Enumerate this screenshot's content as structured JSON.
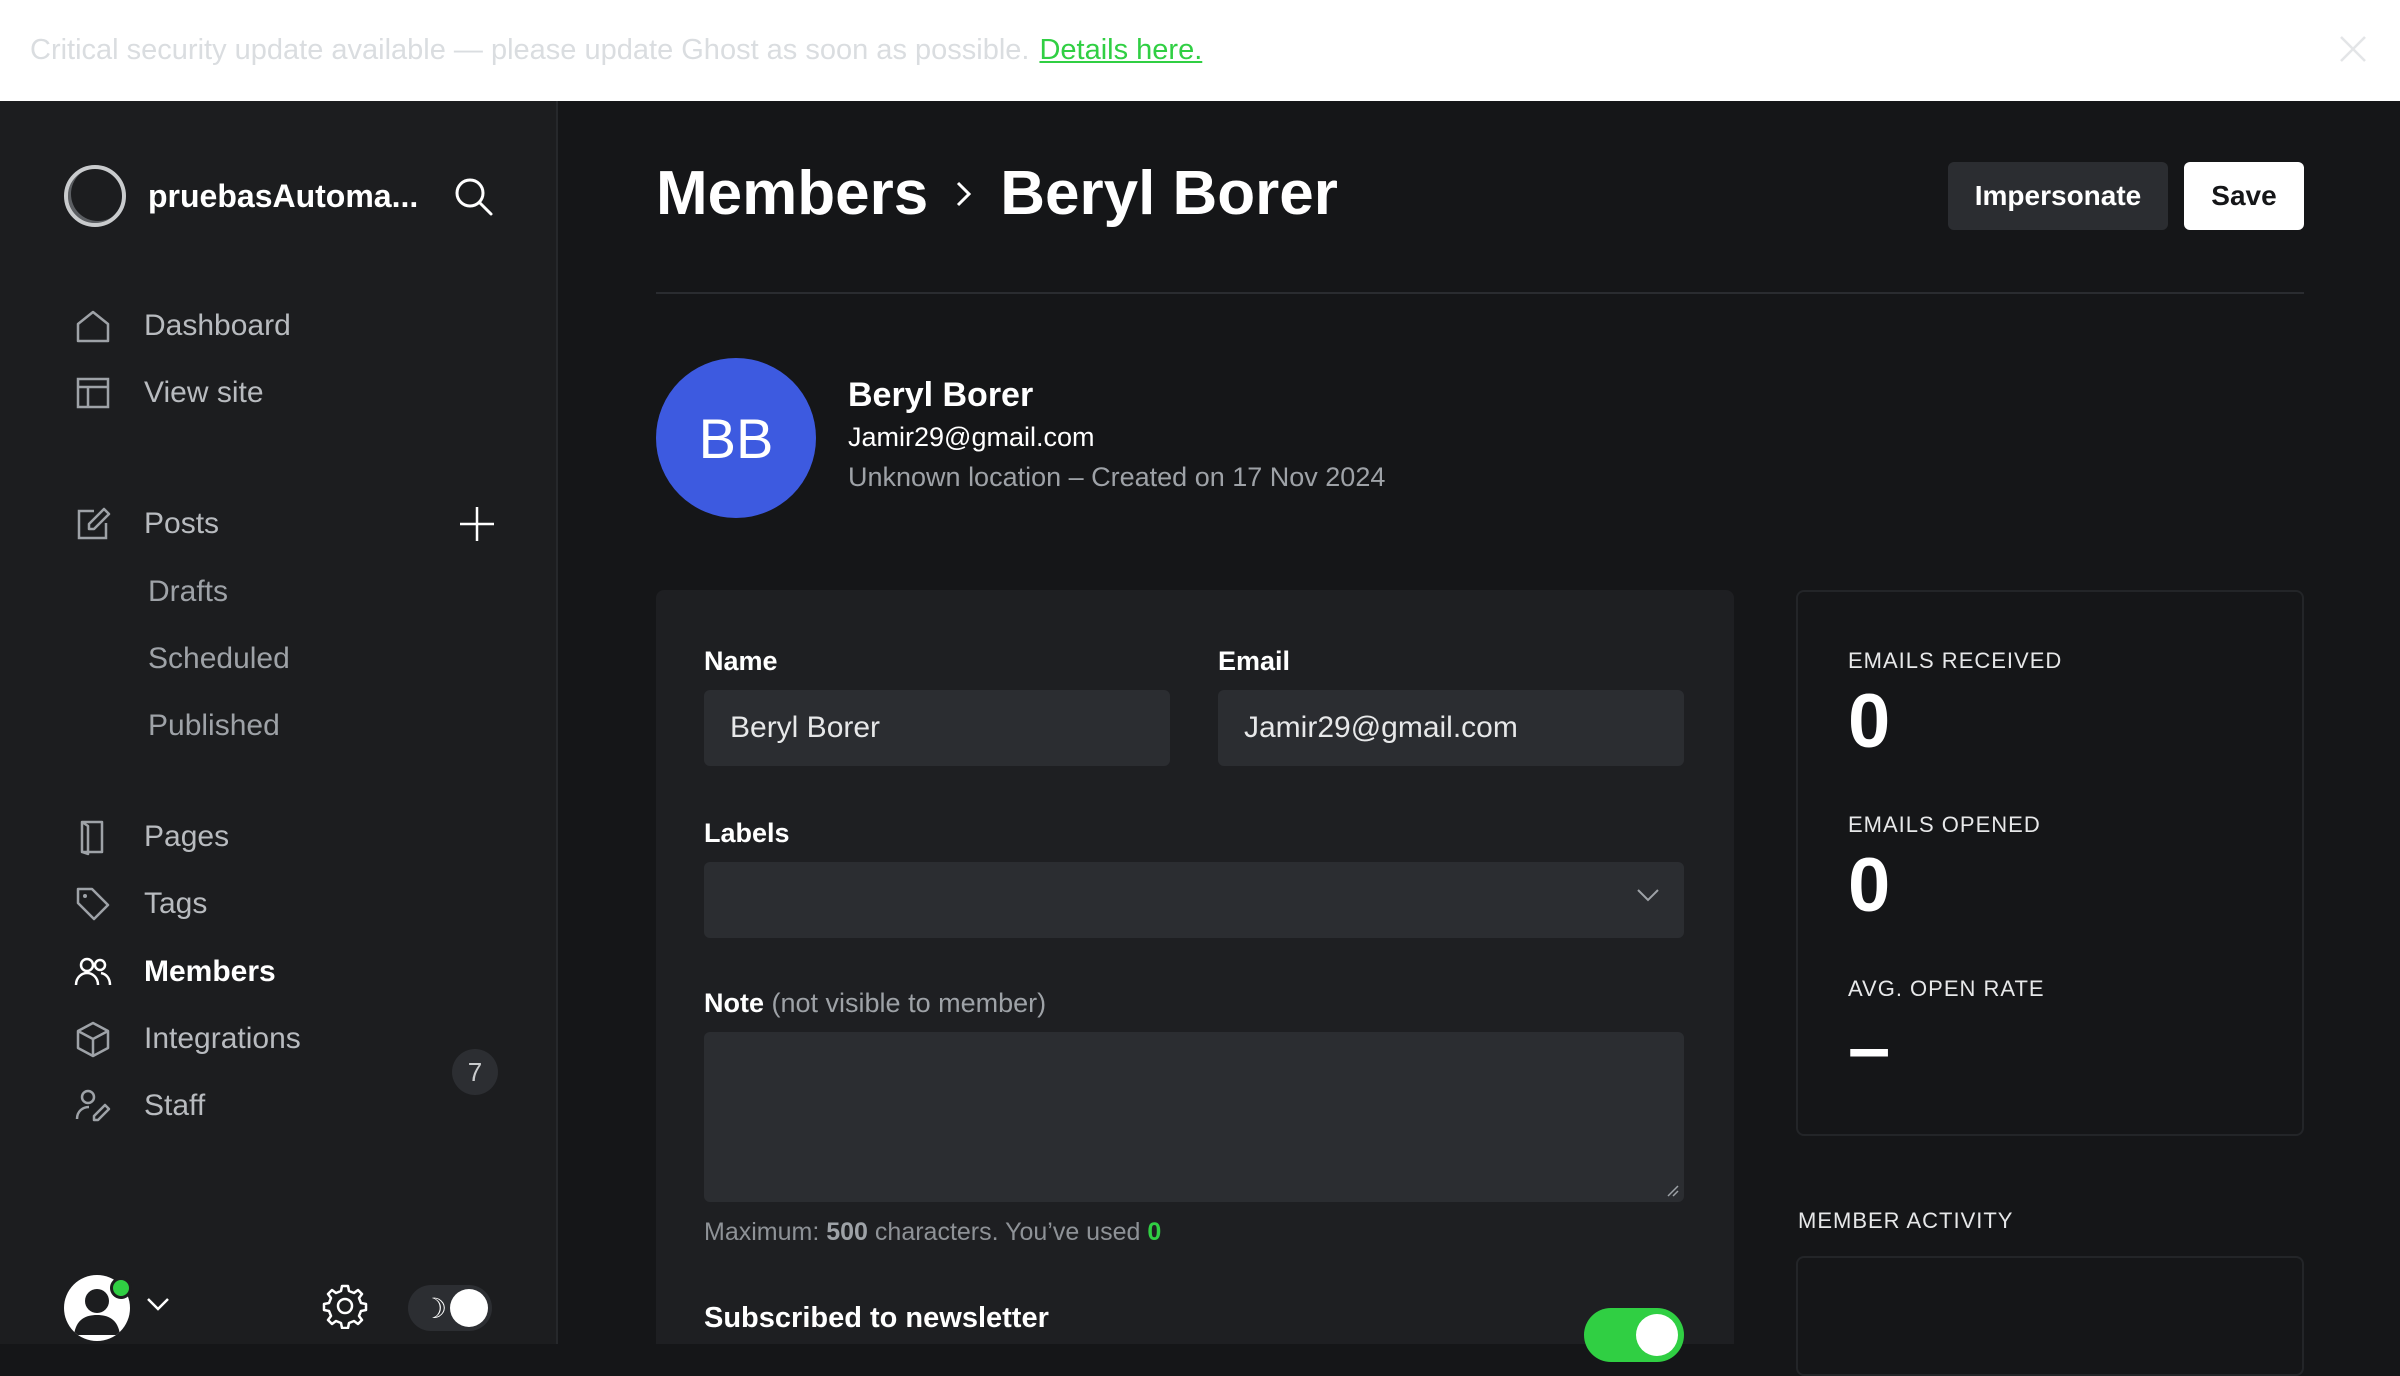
{
  "banner": {
    "text": "Critical security update available — please update Ghost as soon as possible.",
    "link": "Details here."
  },
  "sidebar": {
    "site_name": "pruebasAutoma...",
    "nav": [
      {
        "label": "Dashboard",
        "icon": "home-icon"
      },
      {
        "label": "View site",
        "icon": "layout-icon"
      },
      {
        "label": "Posts",
        "icon": "edit-icon"
      },
      {
        "label": "Pages",
        "icon": "page-icon"
      },
      {
        "label": "Tags",
        "icon": "tag-icon"
      },
      {
        "label": "Members",
        "icon": "members-icon"
      },
      {
        "label": "Integrations",
        "icon": "box-icon"
      },
      {
        "label": "Staff",
        "icon": "staff-icon"
      }
    ],
    "posts_sub": [
      "Drafts",
      "Scheduled",
      "Published"
    ],
    "members_count": "7",
    "theme_icon": "☽"
  },
  "header": {
    "breadcrumb_parent": "Members",
    "breadcrumb_current": "Beryl Borer",
    "impersonate_label": "Impersonate",
    "save_label": "Save"
  },
  "profile": {
    "initials": "BB",
    "name": "Beryl Borer",
    "email": "Jamir29@gmail.com",
    "meta": "Unknown location – Created on 17 Nov 2024"
  },
  "form": {
    "name_label": "Name",
    "name_value": "Beryl Borer",
    "email_label": "Email",
    "email_value": "Jamir29@gmail.com",
    "labels_label": "Labels",
    "note_label": "Note",
    "note_hint": "(not visible to member)",
    "counter_prefix": "Maximum:",
    "counter_max": "500",
    "counter_mid": "characters. You’ve used",
    "counter_used": "0",
    "newsletter_label": "Subscribed to newsletter",
    "newsletter_on": true
  },
  "stats": {
    "emails_received_label": "EMAILS RECEIVED",
    "emails_received": "0",
    "emails_opened_label": "EMAILS OPENED",
    "emails_opened": "0",
    "open_rate_label": "AVG. OPEN RATE",
    "open_rate": "–",
    "activity_label": "MEMBER ACTIVITY"
  },
  "colors": {
    "accent_green": "#30cf43",
    "avatar_blue": "#3d5ae0",
    "background": "#151618"
  }
}
